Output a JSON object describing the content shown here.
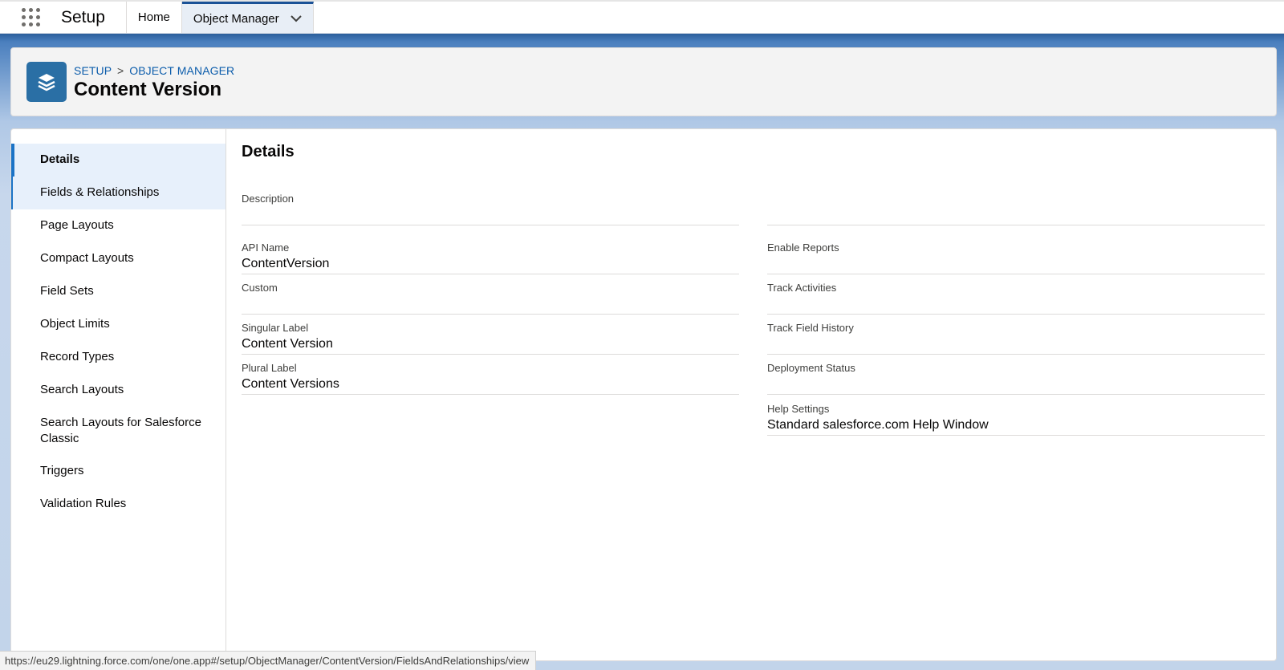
{
  "topnav": {
    "app_launcher_icon": "app-launcher-grid-icon",
    "app_name": "Setup",
    "tabs": [
      {
        "label": "Home"
      },
      {
        "label": "Object Manager",
        "active": true,
        "icon": "chevron-down-icon"
      }
    ]
  },
  "header": {
    "object_icon": "stacked-layers-icon",
    "icon_color": "#2a6fa5",
    "breadcrumbs": [
      "SETUP",
      "OBJECT MANAGER"
    ],
    "breadcrumb_separator": ">",
    "title": "Content Version"
  },
  "sidebar": {
    "items": [
      {
        "label": "Details",
        "state": "selected"
      },
      {
        "label": "Fields & Relationships",
        "state": "hover"
      },
      {
        "label": "Page Layouts"
      },
      {
        "label": "Compact Layouts"
      },
      {
        "label": "Field Sets"
      },
      {
        "label": "Object Limits"
      },
      {
        "label": "Record Types"
      },
      {
        "label": "Search Layouts"
      },
      {
        "label": "Search Layouts for Salesforce Classic"
      },
      {
        "label": "Triggers"
      },
      {
        "label": "Validation Rules"
      }
    ]
  },
  "details": {
    "title": "Details",
    "description": {
      "label": "Description",
      "value": ""
    },
    "left_fields": [
      {
        "label": "API Name",
        "value": "ContentVersion"
      },
      {
        "label": "Custom",
        "value": ""
      },
      {
        "label": "Singular Label",
        "value": "Content Version"
      },
      {
        "label": "Plural Label",
        "value": "Content Versions"
      }
    ],
    "right_fields": [
      {
        "label": "Enable Reports",
        "value": ""
      },
      {
        "label": "Track Activities",
        "value": ""
      },
      {
        "label": "Track Field History",
        "value": ""
      },
      {
        "label": "Deployment Status",
        "value": ""
      },
      {
        "label": "Help Settings",
        "value": "Standard salesforce.com Help Window"
      }
    ]
  },
  "statusbar": {
    "url": "https://eu29.lightning.force.com/one/one.app#/setup/ObjectManager/ContentVersion/FieldsAndRelationships/view"
  },
  "colors": {
    "brand_blue": "#1b5297",
    "link_blue": "#0b5cab",
    "selected_bg": "#e7f0fb",
    "accent_border": "#1b73c6"
  }
}
